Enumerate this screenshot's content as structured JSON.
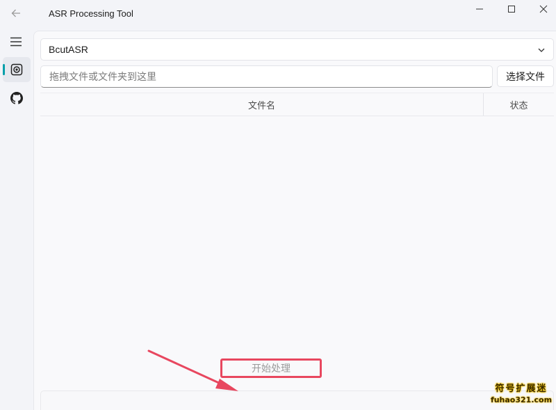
{
  "window": {
    "title": "ASR Processing Tool"
  },
  "nav": {
    "items": [
      {
        "icon": "hamburger-menu-icon"
      },
      {
        "icon": "asr-icon",
        "active": true
      },
      {
        "icon": "github-icon"
      }
    ]
  },
  "asr": {
    "engine_selected": "BcutASR",
    "file_input_placeholder": "拖拽文件或文件夹到这里",
    "select_file_label": "选择文件",
    "table": {
      "columns": [
        "文件名",
        "状态"
      ],
      "rows": []
    },
    "start_label": "开始处理"
  },
  "watermark": {
    "line1": "符号扩展迷",
    "line2": "fuhao321.com"
  },
  "colors": {
    "accent": "#009faa",
    "highlight_box": "#e8475f",
    "arrow": "#e8475f"
  }
}
